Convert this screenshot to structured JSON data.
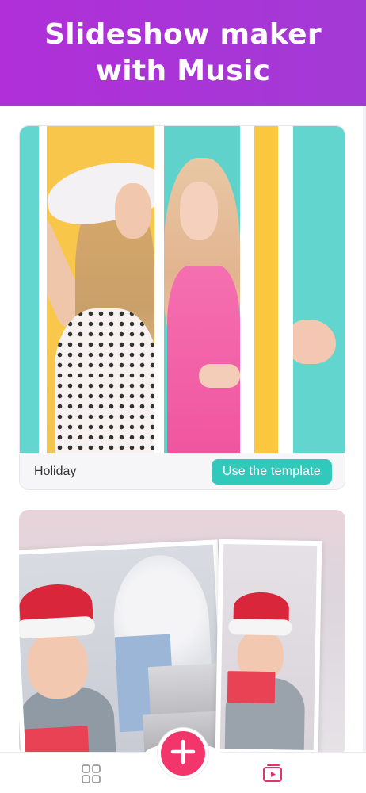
{
  "banner": {
    "line1": "Slideshow maker",
    "line2": "with Music"
  },
  "templates": [
    {
      "name": "Holiday",
      "button_label": "Use the template"
    }
  ],
  "tabbar": {
    "left_icon": "grid-icon",
    "center_icon": "plus-icon",
    "right_icon": "video-icon"
  },
  "colors": {
    "banner": "#b02fd8",
    "accent_teal": "#31c9bb",
    "add_button": "#f2356a",
    "active_tab": "#e0356b",
    "inactive_tab": "#999999"
  }
}
